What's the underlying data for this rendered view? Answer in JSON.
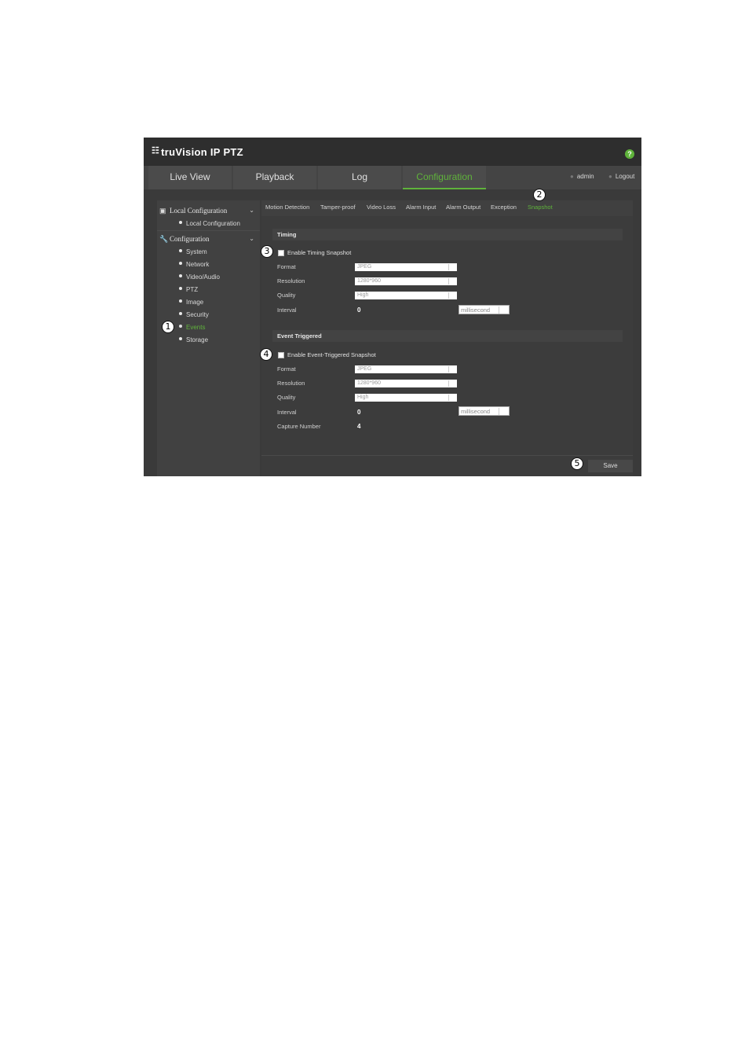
{
  "app": {
    "logo_glyph": "☷",
    "title": "truVision IP PTZ",
    "help_icon_glyph": "?"
  },
  "nav": {
    "tabs": [
      {
        "label": "Live View"
      },
      {
        "label": "Playback"
      },
      {
        "label": "Log"
      },
      {
        "label": "Configuration"
      }
    ],
    "user": "admin",
    "logout": "Logout",
    "accent_color": "#5fb33b"
  },
  "sidebar": {
    "local_group": "Local Configuration",
    "local_item": "Local Configuration",
    "config_group": "Configuration",
    "items": [
      {
        "label": "System"
      },
      {
        "label": "Network"
      },
      {
        "label": "Video/Audio"
      },
      {
        "label": "PTZ"
      },
      {
        "label": "Image"
      },
      {
        "label": "Security"
      },
      {
        "label": "Events"
      },
      {
        "label": "Storage"
      }
    ]
  },
  "subtabs": [
    {
      "label": "Motion Detection"
    },
    {
      "label": "Tamper-proof"
    },
    {
      "label": "Video Loss"
    },
    {
      "label": "Alarm Input"
    },
    {
      "label": "Alarm Output"
    },
    {
      "label": "Exception"
    },
    {
      "label": "Snapshot"
    }
  ],
  "timing": {
    "header": "Timing",
    "enable_label": "Enable Timing Snapshot",
    "format_label": "Format",
    "format_value": "JPEG",
    "resolution_label": "Resolution",
    "resolution_value": "1280*960",
    "quality_label": "Quality",
    "quality_value": "High",
    "interval_label": "Interval",
    "interval_value": "0",
    "interval_unit": "millisecond"
  },
  "event": {
    "header": "Event Triggered",
    "enable_label": "Enable Event-Triggered Snapshot",
    "format_label": "Format",
    "format_value": "JPEG",
    "resolution_label": "Resolution",
    "resolution_value": "1280*960",
    "quality_label": "Quality",
    "quality_value": "High",
    "interval_label": "Interval",
    "interval_value": "0",
    "interval_unit": "millisecond",
    "capture_label": "Capture Number",
    "capture_value": "4"
  },
  "save_label": "Save",
  "callouts": [
    "1",
    "2",
    "3",
    "4",
    "5"
  ]
}
